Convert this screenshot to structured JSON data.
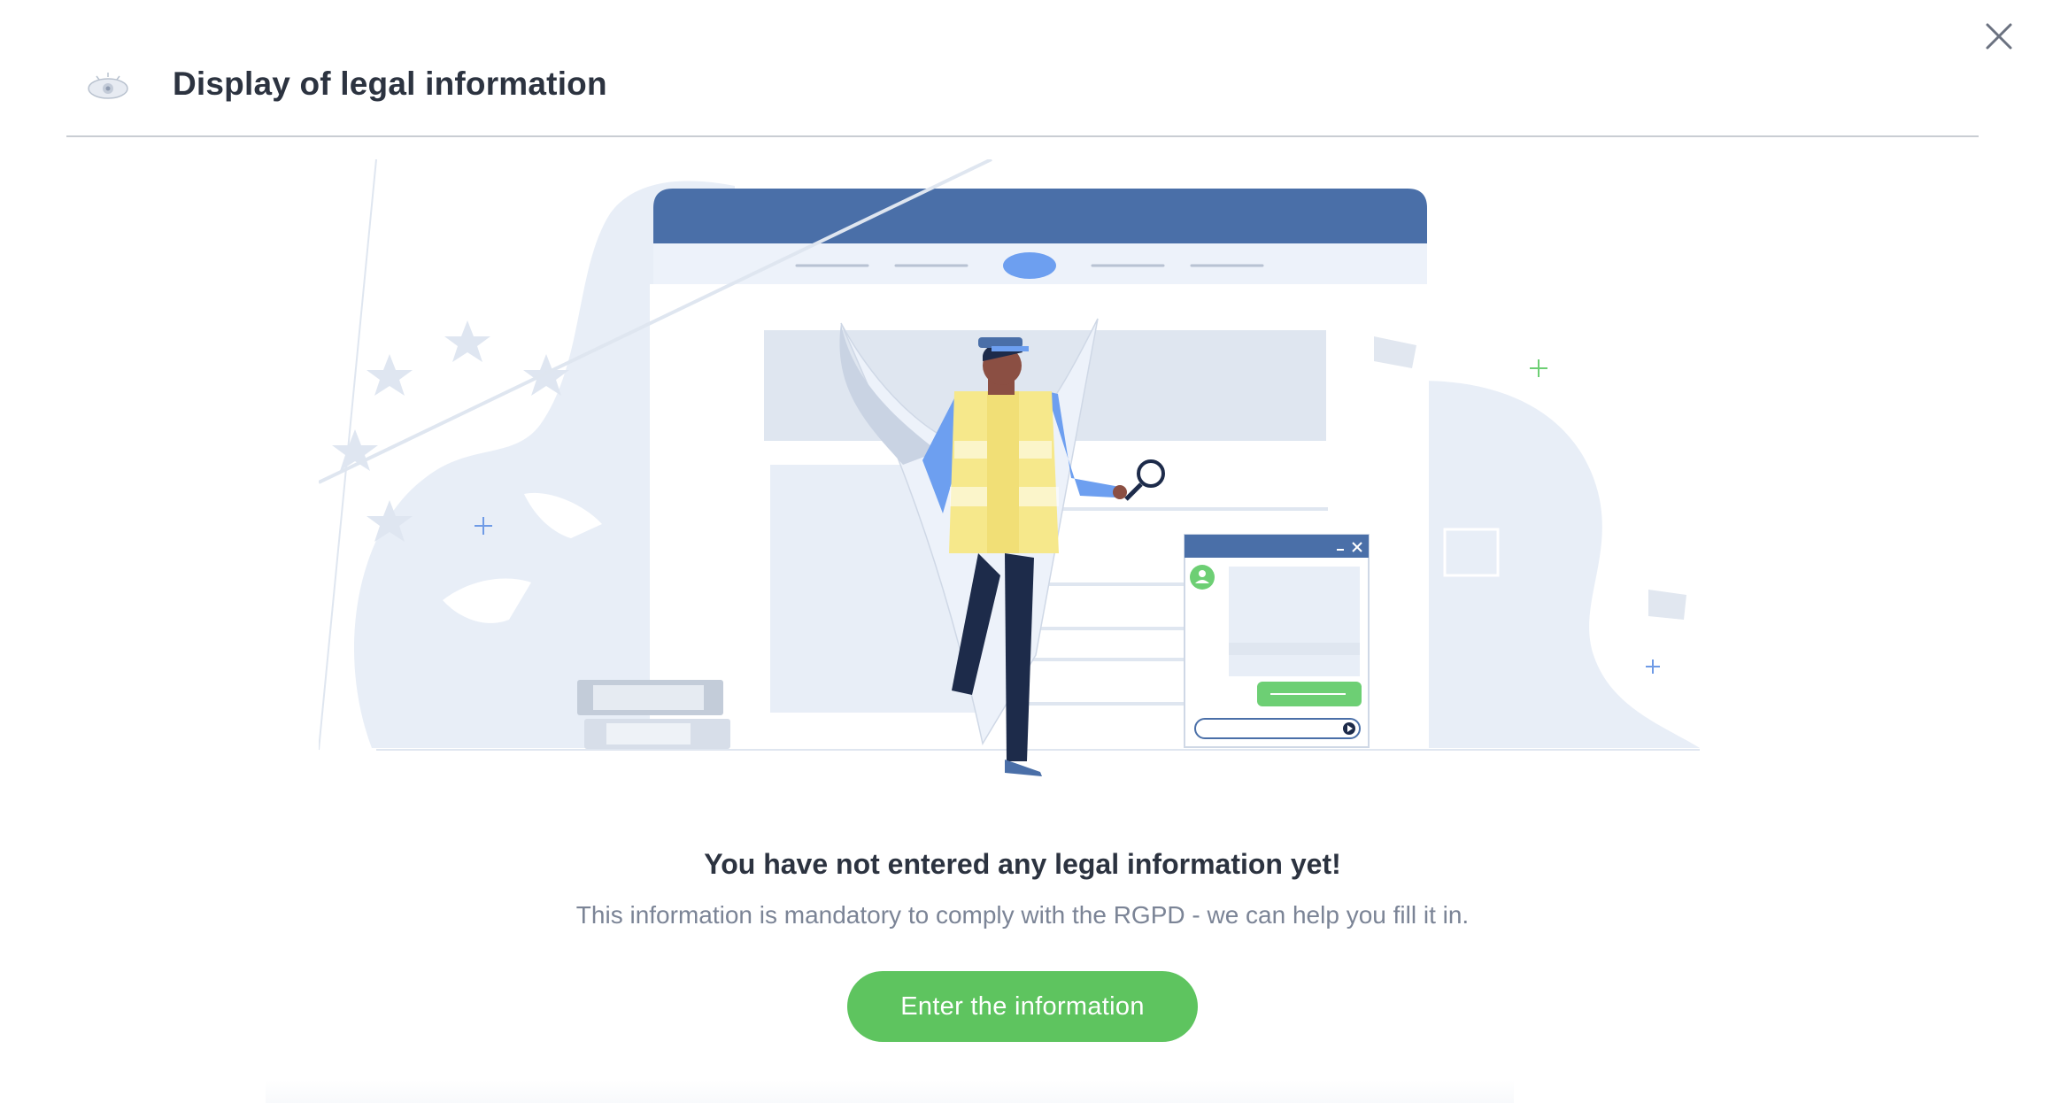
{
  "dialog": {
    "title": "Display of legal information",
    "header_icon": "eye-icon",
    "close_icon": "close-icon"
  },
  "empty_state": {
    "title": "You have not entered any legal information yet!",
    "description": "This information is mandatory to comply with the RGPD - we can help you fill it in.",
    "cta_label": "Enter the information"
  },
  "colors": {
    "accent_green": "#5ec45f",
    "browser_header_blue": "#4a6fa8",
    "illustration_light": "#e8eef7",
    "text_dark": "#2c3340",
    "text_muted": "#7b8496"
  }
}
